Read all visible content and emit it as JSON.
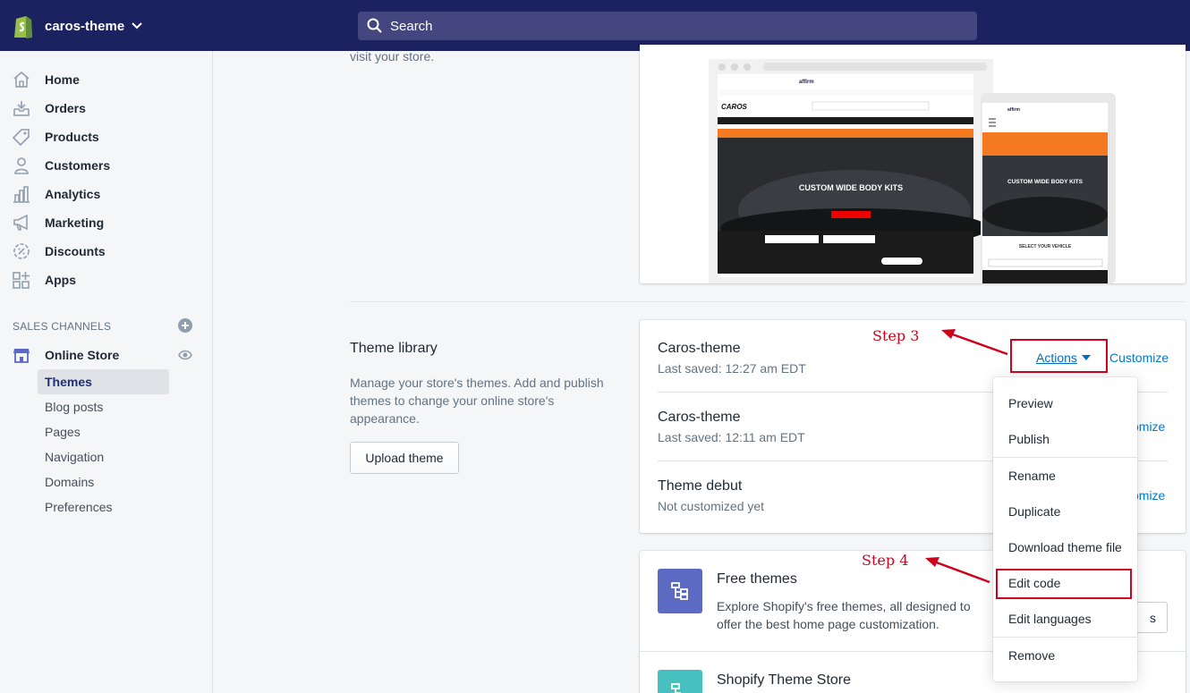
{
  "topbar": {
    "store_name": "caros-theme",
    "search_placeholder": "Search"
  },
  "sidebar": {
    "items": [
      {
        "label": "Home",
        "icon": "home-icon"
      },
      {
        "label": "Orders",
        "icon": "orders-icon"
      },
      {
        "label": "Products",
        "icon": "tag-icon"
      },
      {
        "label": "Customers",
        "icon": "person-icon"
      },
      {
        "label": "Analytics",
        "icon": "bar-chart-icon"
      },
      {
        "label": "Marketing",
        "icon": "megaphone-icon"
      },
      {
        "label": "Discounts",
        "icon": "discount-icon"
      },
      {
        "label": "Apps",
        "icon": "apps-icon"
      }
    ],
    "sales_channels_heading": "SALES CHANNELS",
    "online_store_label": "Online Store",
    "sub_items": [
      {
        "label": "Themes",
        "active": true
      },
      {
        "label": "Blog posts"
      },
      {
        "label": "Pages"
      },
      {
        "label": "Navigation"
      },
      {
        "label": "Domains"
      },
      {
        "label": "Preferences"
      }
    ]
  },
  "main": {
    "top_text": "visit your store.",
    "library_title": "Theme library",
    "library_desc_1": "Manage your store's themes. Add and publish",
    "library_desc_2": "themes to change your online store's",
    "library_desc_3": "appearance.",
    "upload_label": "Upload theme",
    "themes": [
      {
        "name": "Caros-theme",
        "meta": "Last saved: 12:27 am EDT"
      },
      {
        "name": "Caros-theme",
        "meta": "Last saved: 12:11 am EDT"
      },
      {
        "name": "Theme debut",
        "meta": "Not customized yet"
      }
    ],
    "actions_label": "Actions",
    "customize_label": "Customize",
    "customize_partial": "omize"
  },
  "dropdown": {
    "items": [
      "Preview",
      "Publish",
      "Rename",
      "Duplicate",
      "Download theme file",
      "Edit code",
      "Edit languages",
      "Remove"
    ]
  },
  "annotations": {
    "step3": "Step 3",
    "step4": "Step 4",
    "color": "#d0021b"
  },
  "free_themes": {
    "title": "Free themes",
    "desc_1": "Explore Shopify's free themes, all designed to",
    "desc_2": "offer the best home page customization.",
    "button_partial": "s",
    "store_title": "Shopify Theme Store"
  },
  "preview": {
    "desktop_brand": "CAROS",
    "desktop_hero": "CUSTOM WIDE BODY KITS",
    "mobile_hero": "CUSTOM WIDE BODY KITS",
    "mobile_select": "SELECT YOUR VEHICLE",
    "affirm": "affirm"
  },
  "colors": {
    "topbar": "#1c2260",
    "accent": "#007ace",
    "active_nav": "#202e78",
    "annotation": "#d0021b"
  }
}
